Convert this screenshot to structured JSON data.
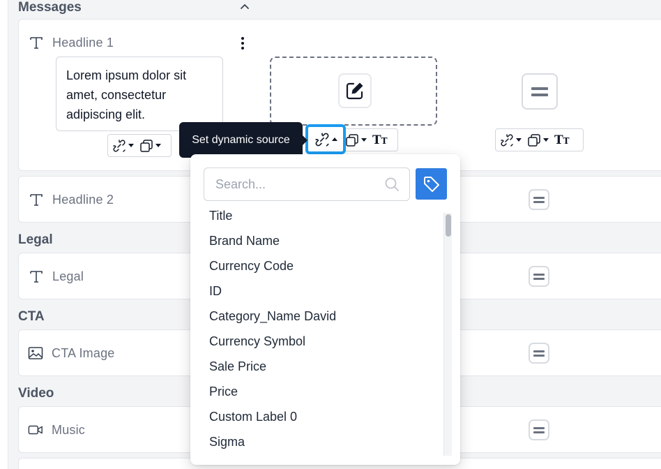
{
  "sections": {
    "messages": "Messages",
    "legal": "Legal",
    "cta": "CTA",
    "video": "Video"
  },
  "rows": {
    "headline1": "Headline 1",
    "headline2": "Headline 2",
    "legal": "Legal",
    "cta_image": "CTA Image",
    "music": "Music"
  },
  "headline1": {
    "text_content": "Lorem ipsum dolor sit amet, consectetur adipiscing elit."
  },
  "tooltip": "Set dynamic source",
  "dropdown": {
    "search_placeholder": "Search...",
    "search_value": "",
    "items": [
      "Title",
      "Brand Name",
      "Currency Code",
      "ID",
      "Category_Name David",
      "Currency Symbol",
      "Sale Price",
      "Price",
      "Custom Label 0",
      "Sigma"
    ]
  },
  "colors": {
    "highlight": "#1a9bf0",
    "tag_button": "#2f7ee3",
    "tooltip_bg": "#111827"
  },
  "icons": {
    "row_text": "text-type-icon",
    "row_image": "image-icon",
    "row_video": "video-icon",
    "link": "dynamic-link-icon",
    "copy": "copy-icon",
    "text_size": "text-size-icon",
    "edit": "edit-icon",
    "equals": "equals-icon",
    "search": "search-icon",
    "tag": "tag-icon"
  }
}
